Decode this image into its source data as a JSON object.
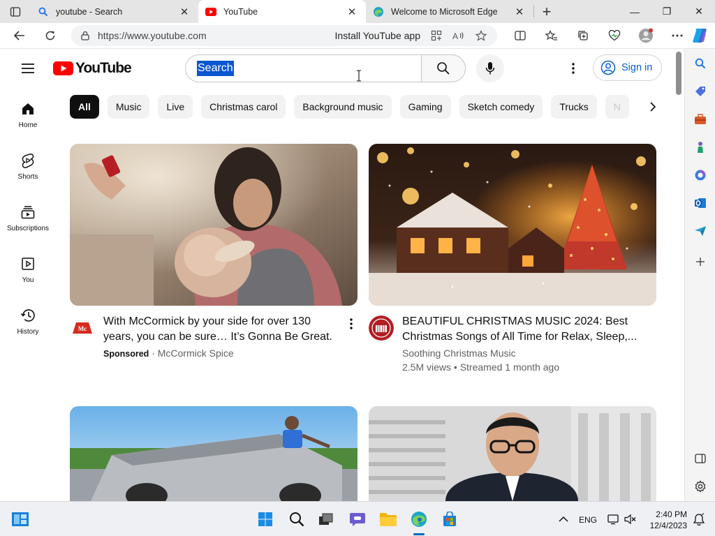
{
  "browser": {
    "tabs": [
      {
        "title": "youtube - Search",
        "icon": "search-icon"
      },
      {
        "title": "YouTube",
        "icon": "youtube-icon",
        "active": true
      },
      {
        "title": "Welcome to Microsoft Edge",
        "icon": "edge-icon"
      }
    ],
    "url": "https://www.youtube.com",
    "install_label": "Install YouTube app"
  },
  "header": {
    "logo_text": "YouTube",
    "search_value": "Search",
    "signin_label": "Sign in"
  },
  "guide": [
    {
      "label": "Home",
      "icon": "home-icon"
    },
    {
      "label": "Shorts",
      "icon": "shorts-icon"
    },
    {
      "label": "Subscriptions",
      "icon": "subscriptions-icon"
    },
    {
      "label": "You",
      "icon": "you-icon"
    },
    {
      "label": "History",
      "icon": "history-icon"
    }
  ],
  "chips": [
    "All",
    "Music",
    "Live",
    "Christmas carol",
    "Background music",
    "Gaming",
    "Sketch comedy",
    "Trucks",
    "N"
  ],
  "videos": [
    {
      "title_line1": "With McCormick by your side for over 130",
      "title_line2": "years, you can be sure… It’s Gonna Be Great.",
      "sponsored": "Sponsored",
      "channel": "McCormick Spice"
    },
    {
      "title_line1": "BEAUTIFUL CHRISTMAS MUSIC 2024: Best",
      "title_line2": "Christmas Songs of All Time for Relax, Sleep,...",
      "channel": "Soothing Christmas Music",
      "stats": "2.5M views • Streamed 1 month ago"
    }
  ],
  "taskbar": {
    "lang": "ENG",
    "time": "2:40 PM",
    "date": "12/4/2023"
  },
  "colors": {
    "youtube_red": "#ff0000",
    "link_blue": "#065fd4",
    "selection_blue": "#0b57d0"
  }
}
